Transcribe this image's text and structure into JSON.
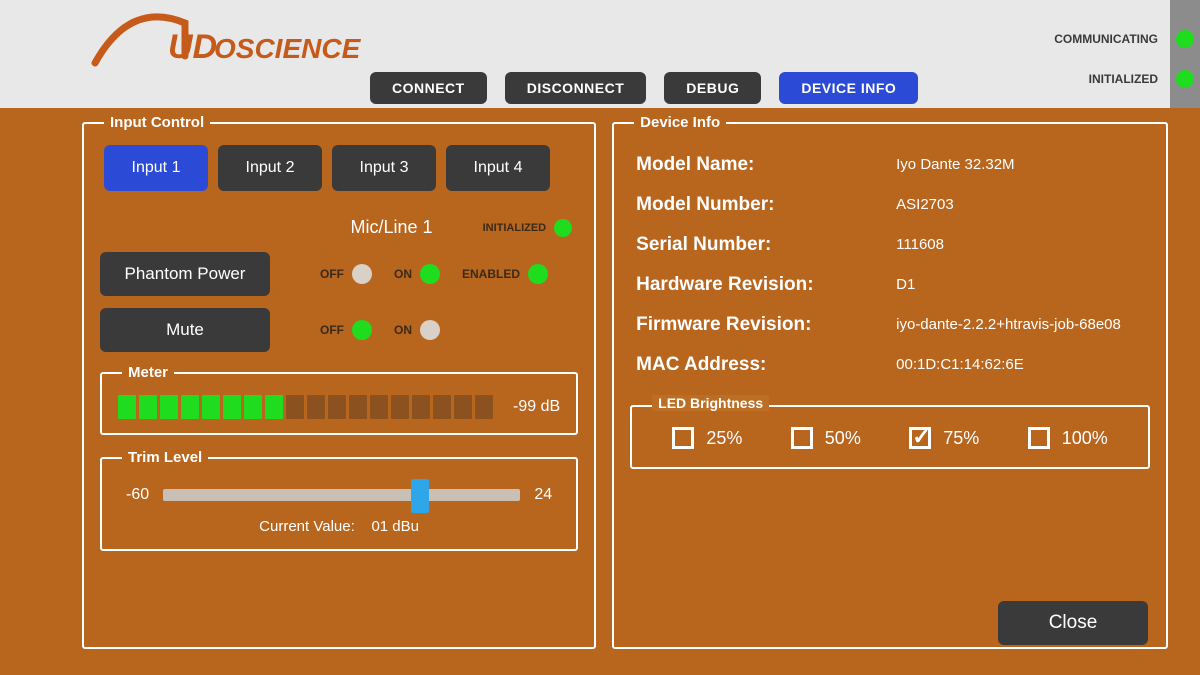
{
  "logo_text": "AUDIOSCIENCE",
  "toolbar": {
    "connect": "CONNECT",
    "disconnect": "DISCONNECT",
    "debug": "DEBUG",
    "device_info": "DEVICE INFO"
  },
  "status": {
    "comm_label": "COMMUNICATING",
    "init_label": "INITIALIZED"
  },
  "input_control": {
    "legend": "Input Control",
    "tabs": [
      "Input 1",
      "Input 2",
      "Input 3",
      "Input 4"
    ],
    "selected_tab": 0,
    "channel_label": "Mic/Line 1",
    "initialized_label": "INITIALIZED",
    "phantom": {
      "button": "Phantom Power",
      "off_label": "OFF",
      "on_label": "ON",
      "enabled_label": "ENABLED",
      "state": "on",
      "enabled": true
    },
    "mute": {
      "button": "Mute",
      "off_label": "OFF",
      "on_label": "ON",
      "state": "off"
    },
    "meter": {
      "legend": "Meter",
      "segments_on": 8,
      "segments_total": 18,
      "value": "-99 dB"
    },
    "trim": {
      "legend": "Trim Level",
      "min": "-60",
      "max": "24",
      "current_label": "Current Value:",
      "current_value": "01 dBu",
      "percent": 72
    }
  },
  "device_info": {
    "legend": "Device Info",
    "rows": [
      {
        "label": "Model Name:",
        "value": "Iyo Dante 32.32M"
      },
      {
        "label": "Model Number:",
        "value": "ASI2703"
      },
      {
        "label": "Serial Number:",
        "value": "111608"
      },
      {
        "label": "Hardware Revision:",
        "value": "D1"
      },
      {
        "label": "Firmware Revision:",
        "value": "iyo-dante-2.2.2+htravis-job-68e08"
      },
      {
        "label": "MAC Address:",
        "value": "00:1D:C1:14:62:6E"
      }
    ],
    "led_brightness": {
      "legend": "LED Brightness",
      "options": [
        "25%",
        "50%",
        "75%",
        "100%"
      ],
      "selected": 2
    },
    "close": "Close"
  }
}
